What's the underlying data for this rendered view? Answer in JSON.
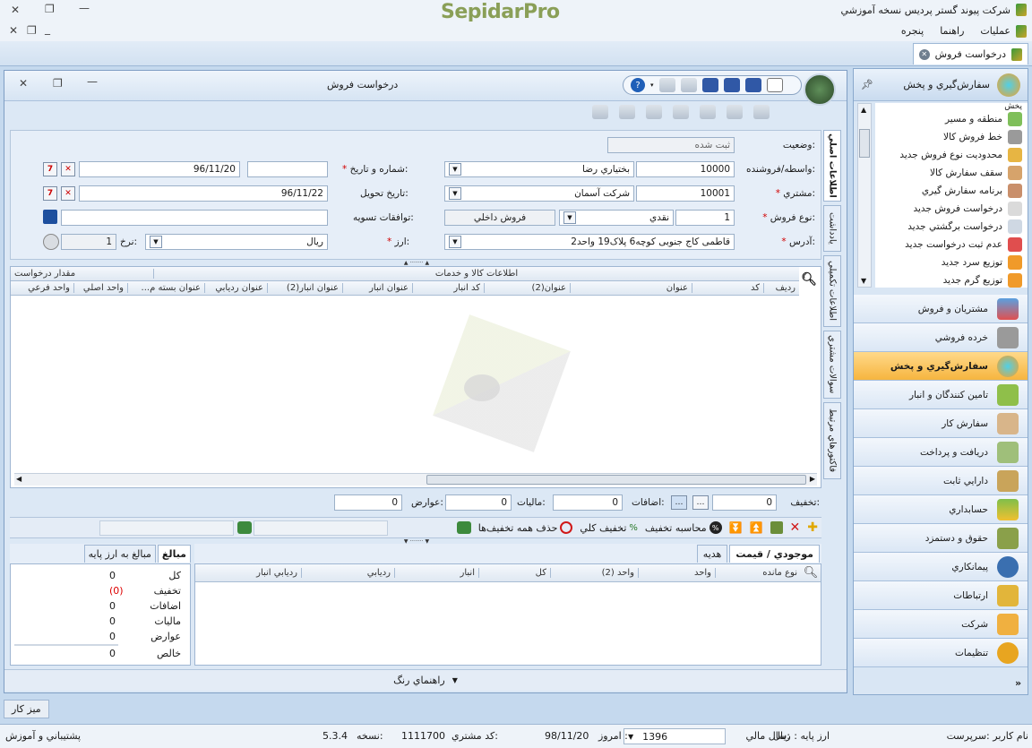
{
  "app": {
    "title": "شرکت پیوند گستر پردیس نسخه آموزشي",
    "logo": "SepidarPro",
    "menu": [
      "عمليات",
      "راهنما",
      "پنجره"
    ],
    "doc_tab": "درخواست فروش"
  },
  "nav": {
    "header": "سفارش‌گيري و پخش",
    "tree_top": "پخش",
    "tree": [
      "منطقه و مسير",
      "خط فروش کالا",
      "محدوديت نوع فروش جديد",
      "سقف سفارش کالا",
      "برنامه سفارش گيري",
      "درخواست فروش جديد",
      "درخواست برگشتي جديد",
      "عدم ثبت درخواست جديد",
      "توزيع سرد جديد",
      "توزيع گرم جديد"
    ],
    "modules": [
      "مشتريان و فروش",
      "خرده فروشي",
      "سفارش‌گيري و پخش",
      "تامين کنندگان و انبار",
      "سفارش کار",
      "دريافت و پرداخت",
      "دارايي ثابت",
      "حسابداري",
      "حقوق و دستمزد",
      "پيمانکاري",
      "ارتباطات",
      "شرکت",
      "تنظيمات"
    ],
    "active_index": 2
  },
  "form": {
    "window_title": "درخواست فروش",
    "labels": {
      "status": "وضعيت:",
      "agent": "واسطه/فروشنده:",
      "customer": "مشتري:",
      "sale_type": "نوع فروش:",
      "address": "آدرس:",
      "number_date": "شماره و تاريخ:",
      "delivery_date": "تاريخ تحويل:",
      "settlement": "توافقات تسويه:",
      "currency": "ارز:",
      "rate": "نرخ:"
    },
    "values": {
      "status": "ثبت شده",
      "agent_code": "10000",
      "agent_name": "بختياري رضا",
      "customer_code": "10001",
      "customer_name": "شرکت آسمان",
      "sale_type_code": "1",
      "sale_type_name": "نقدي",
      "sale_kind": "فروش داخلي",
      "address": "قاطمی کاج جنوبی کوچه6 پلاک19 واحد2",
      "number": "",
      "date": "96/11/20",
      "delivery_date": "96/11/22",
      "settlement": "",
      "currency": "ريال",
      "rate": "1"
    },
    "vertical_tabs": [
      "اطلاعات اصلي",
      "يادداشت",
      "اطلاعات تکميلي",
      "سوالات مشتري",
      "فاکتورهاي مرتبط"
    ]
  },
  "items_grid": {
    "group_header": "اطلاعات کالا و خدمات",
    "group_header2": "مقدار درخواست",
    "columns": [
      "رديف",
      "کد",
      "عنوان",
      "عنوان(2)",
      "کد انبار",
      "عنوان انبار",
      "عنوان انبار(2)",
      "عنوان رديابي",
      "عنوان بسته م...",
      "واحد اصلي",
      "واحد فرعي"
    ]
  },
  "totals_row": {
    "discount_label": "تخفيف:",
    "discount": "0",
    "additions_label": "اضافات:",
    "additions": "0",
    "tax_label": "ماليات:",
    "tax": "0",
    "duties_label": "عوارض:",
    "duties": "0"
  },
  "actions": {
    "calc_discount": "محاسبه تخفيف",
    "total_discount": "تخفيف کلي",
    "remove_discounts": "حذف همه تخفيف‌ها"
  },
  "stock": {
    "tabs": [
      "موجودي / قيمت",
      "هديه"
    ],
    "columns": [
      "نوع مانده",
      "واحد",
      "واحد (2)",
      "کل",
      "انبار",
      "رديابي",
      "رديابي انبار"
    ]
  },
  "amounts": {
    "tabs": [
      "مبالغ",
      "مبالغ به ارز پايه"
    ],
    "rows": [
      {
        "label": "کل",
        "value": "0"
      },
      {
        "label": "تخفيف",
        "value": "(0)"
      },
      {
        "label": "اضافات",
        "value": "0"
      },
      {
        "label": "ماليات",
        "value": "0"
      },
      {
        "label": "عوارض",
        "value": "0"
      },
      {
        "label": "خالص",
        "value": "0"
      }
    ]
  },
  "color_guide": "راهنماي رنگ",
  "taskbar": "ميز کار",
  "status": {
    "user": "نام کاربر :سرپرست",
    "base_currency": "ارز پايه :  ريال",
    "fiscal_year_label": "سال مالي:",
    "fiscal_year": "1396",
    "today_label": "امروز :",
    "today": "98/11/20",
    "customer_code_label": "کد مشتري:",
    "customer_code": "1111700",
    "version_label": "نسخه:",
    "version": "5.3.4",
    "support": "پشتيباني و آموزش"
  },
  "colors": {
    "accent": "#f6b53f",
    "frame": "#7f9ec4",
    "logo": "#8a9f57"
  }
}
